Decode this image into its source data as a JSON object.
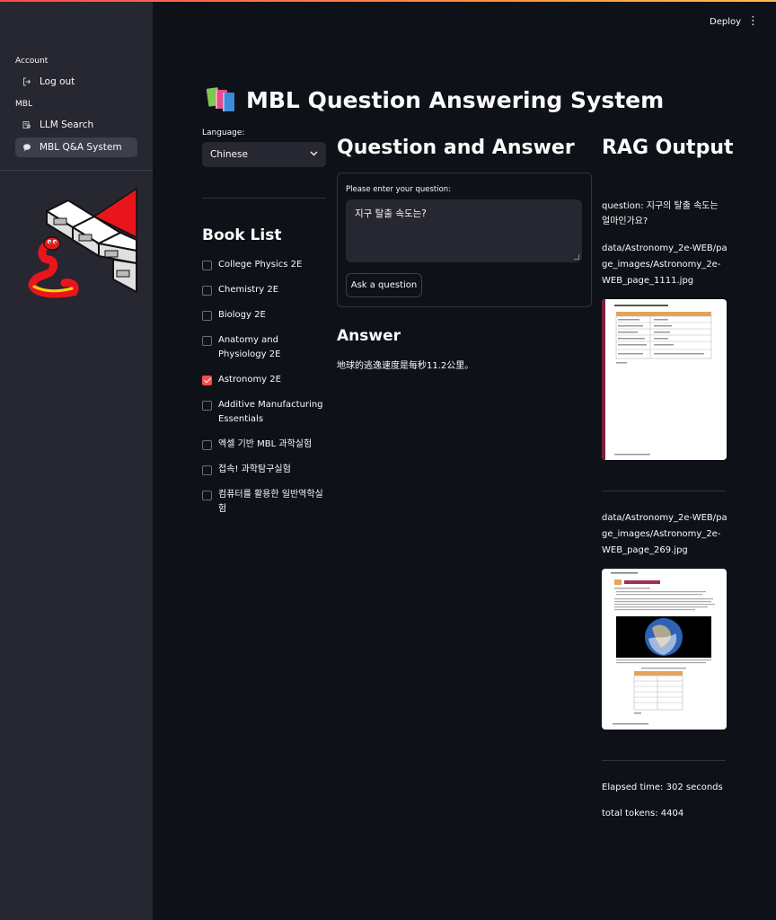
{
  "header": {
    "deploy_label": "Deploy",
    "menu_icon": "kebab-menu-icon"
  },
  "sidebar": {
    "account_section": "Account",
    "logout_label": "Log out",
    "mbl_section": "MBL",
    "nav": [
      {
        "label": "LLM Search",
        "icon": "search-page-icon"
      },
      {
        "label": "MBL Q&A System",
        "icon": "speech-bubble-icon",
        "active": true
      }
    ]
  },
  "page": {
    "title": "MBL Question Answering System",
    "title_icon": "books-icon"
  },
  "language": {
    "label": "Language:",
    "selected": "Chinese"
  },
  "book_list": {
    "heading": "Book List",
    "items": [
      {
        "label": "College Physics 2E",
        "checked": false
      },
      {
        "label": "Chemistry 2E",
        "checked": false
      },
      {
        "label": "Biology 2E",
        "checked": false
      },
      {
        "label": "Anatomy and Physiology 2E",
        "checked": false
      },
      {
        "label": "Astronomy 2E",
        "checked": true
      },
      {
        "label": "Additive Manufacturing Essentials",
        "checked": false
      },
      {
        "label": "엑셀 기반 MBL 과학실험",
        "checked": false
      },
      {
        "label": "접속! 과학탐구실험",
        "checked": false
      },
      {
        "label": "컴퓨터를 활용한 일반역학실험",
        "checked": false
      }
    ]
  },
  "qa": {
    "heading": "Question and Answer",
    "question_label": "Please enter your question:",
    "question_value": "지구 탈출 속도는?",
    "ask_button": "Ask a question",
    "answer_heading": "Answer",
    "answer_text": "地球的逃逸速度是每秒11.2公里。"
  },
  "rag": {
    "heading": "RAG Output",
    "question": "question: 지구의 탈출 속도는 얼마인가요?",
    "sources": [
      "data/Astronomy_2e-WEB/page_images/Astronomy_2e-WEB_page_1111.jpg",
      "data/Astronomy_2e-WEB/page_images/Astronomy_2e-WEB_page_269.jpg"
    ],
    "elapsed": "Elapsed time: 302 seconds",
    "tokens": "total tokens: 4404"
  },
  "colors": {
    "accent": "#ff4b4b",
    "background": "#0e1117",
    "sidebar": "#262730"
  }
}
